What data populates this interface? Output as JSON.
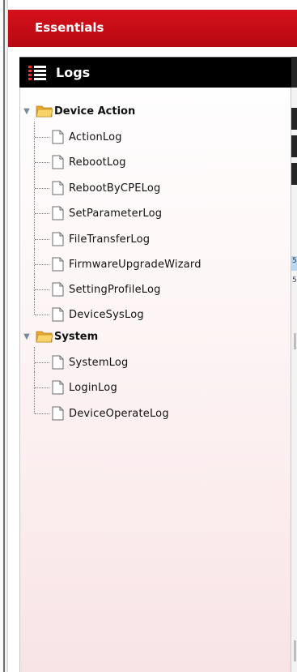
{
  "sidebar": {
    "section_title": "Essentials",
    "panel_title": "Logs",
    "icons": {
      "panel": "menu-list-icon",
      "folder": "folder-open-icon",
      "leaf": "document-icon",
      "expander": "expand-arrow-icon"
    },
    "groups": [
      {
        "label": "Device Action",
        "items": [
          "ActionLog",
          "RebootLog",
          "RebootByCPELog",
          "SetParameterLog",
          "FileTransferLog",
          "FirmwareUpgradeWizard",
          "SettingProfileLog",
          "DeviceSysLog"
        ]
      },
      {
        "label": "System",
        "items": [
          "SystemLog",
          "LoginLog",
          "DeviceOperateLog"
        ]
      }
    ]
  },
  "colors": {
    "header_red": "#c60c15",
    "panel_header_black": "#000000",
    "folder_yellow": "#f5c74a",
    "panel_tint": "#f8e4e6"
  },
  "background_fragments": {
    "clipped_text_1": "5",
    "clipped_text_2": "5"
  }
}
